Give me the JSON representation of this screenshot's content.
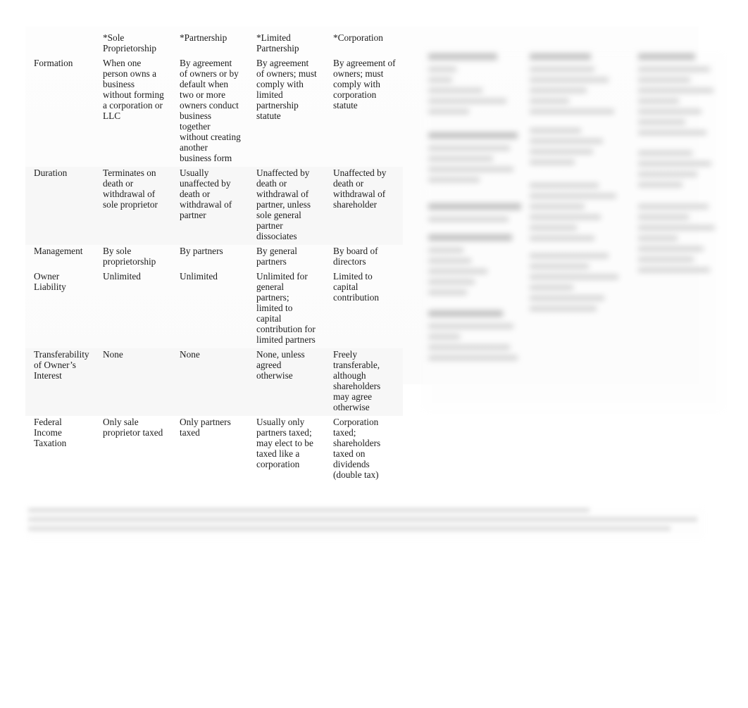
{
  "document": {
    "kind": "business-entity-comparison-table",
    "page_background": "#ffffff",
    "sheet_background": "#fdfdfd",
    "shade_color": "#f7f7f7",
    "text_color": "#1c1c1c"
  },
  "table": {
    "caption": "",
    "row_label_header": "",
    "columns": [
      "",
      "*Sole Proprietorship",
      "*Partnership",
      "*Limited Partnership",
      "*Corporation"
    ],
    "rows": [
      {
        "label": "Formation",
        "cells": [
          "When one person owns a business without forming a corporation or LLC",
          "By agreement of owners or by default when two or more owners conduct business together without creating another business form",
          "By agreement of owners; must comply with limited partnership statute",
          "By agreement of owners; must comply with corporation statute"
        ]
      },
      {
        "label": "Duration",
        "cells": [
          "Terminates on death or withdrawal of sole proprietor",
          "Usually unaffected by death or withdrawal of partner",
          "Unaffected by death or withdrawal of partner, unless sole general partner dissociates",
          "Unaffected by death or withdrawal of shareholder"
        ]
      },
      {
        "label": "Management",
        "cells": [
          "By sole proprietorship",
          "By partners",
          "By general partners",
          "By board of directors"
        ]
      },
      {
        "label": "Owner Liability",
        "cells": [
          "Unlimited",
          "Unlimited",
          "Unlimited for general partners; limited to capital contribution for limited partners",
          "Limited to capital contribution"
        ]
      },
      {
        "label": "Transferability of Owner’s Interest",
        "cells": [
          "None",
          "None",
          "None, unless agreed otherwise",
          "Freely transferable, although shareholders may agree otherwise"
        ]
      },
      {
        "label": "Federal Income Taxation",
        "cells": [
          "Only sale proprietor taxed",
          "Only partners taxed",
          "Usually only partners taxed; may elect to be taxed like a corporation",
          "Corporation taxed; shareholders taxed on dividends (double tax)"
        ]
      }
    ]
  },
  "blurred_content": {
    "right_panel": {
      "description": "Out-of-focus multi-column body text adjacent to the table; characters are not legible.",
      "legible": false
    },
    "footnote_strip": {
      "description": "Out-of-focus single paragraph of footnote text near the bottom of the page; characters are not legible.",
      "legible": false
    }
  }
}
